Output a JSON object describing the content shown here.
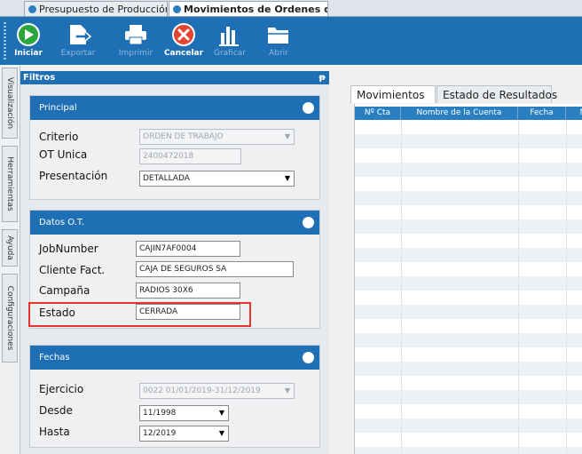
{
  "doc_tabs": [
    {
      "label": "Presupuesto de Producción",
      "active": false
    },
    {
      "label": "Movimientos de Ordenes de Tra...",
      "active": true
    }
  ],
  "toolbar": {
    "iniciar": "Iniciar",
    "exportar": "Exportar",
    "imprimir": "Imprimir",
    "cancelar": "Cancelar",
    "graficar": "Graficar",
    "abrir": "Abrir"
  },
  "side_tabs": [
    "Visualización",
    "Herramientas",
    "Ayuda",
    "Configuraciones"
  ],
  "filtros": {
    "title": "Filtros",
    "pin": "ᵽ"
  },
  "principal": {
    "title": "Principal",
    "criterio_label": "Criterio",
    "criterio_value": "ORDEN DE TRABAJO",
    "ot_label": "OT Unica",
    "ot_value": "2400472018",
    "presentacion_label": "Presentación",
    "presentacion_value": "DETALLADA"
  },
  "datos_ot": {
    "title": "Datos O.T.",
    "jobnumber_label": "JobNumber",
    "jobnumber_value": "CAJIN7AF0004",
    "cliente_label": "Cliente Fact.",
    "cliente_value": "CAJA DE SEGUROS SA",
    "campana_label": "Campaña",
    "campana_value": "RADIOS 30X6",
    "estado_label": "Estado",
    "estado_value": "CERRADA"
  },
  "fechas": {
    "title": "Fechas",
    "ejercicio_label": "Ejercicio",
    "ejercicio_value": "0022 01/01/2019-31/12/2019",
    "desde_label": "Desde",
    "desde_value": "11/1998",
    "hasta_label": "Hasta",
    "hasta_value": "12/2019"
  },
  "result_tabs": [
    {
      "label": "Movimientos",
      "active": true
    },
    {
      "label": "Estado de Resultados",
      "active": false
    }
  ],
  "grid_columns": [
    "Nº Cta",
    "Nombre de la Cuenta",
    "Fecha",
    "M"
  ],
  "colors": {
    "accent": "#1f6fb5",
    "highlight": "#e8332e"
  }
}
